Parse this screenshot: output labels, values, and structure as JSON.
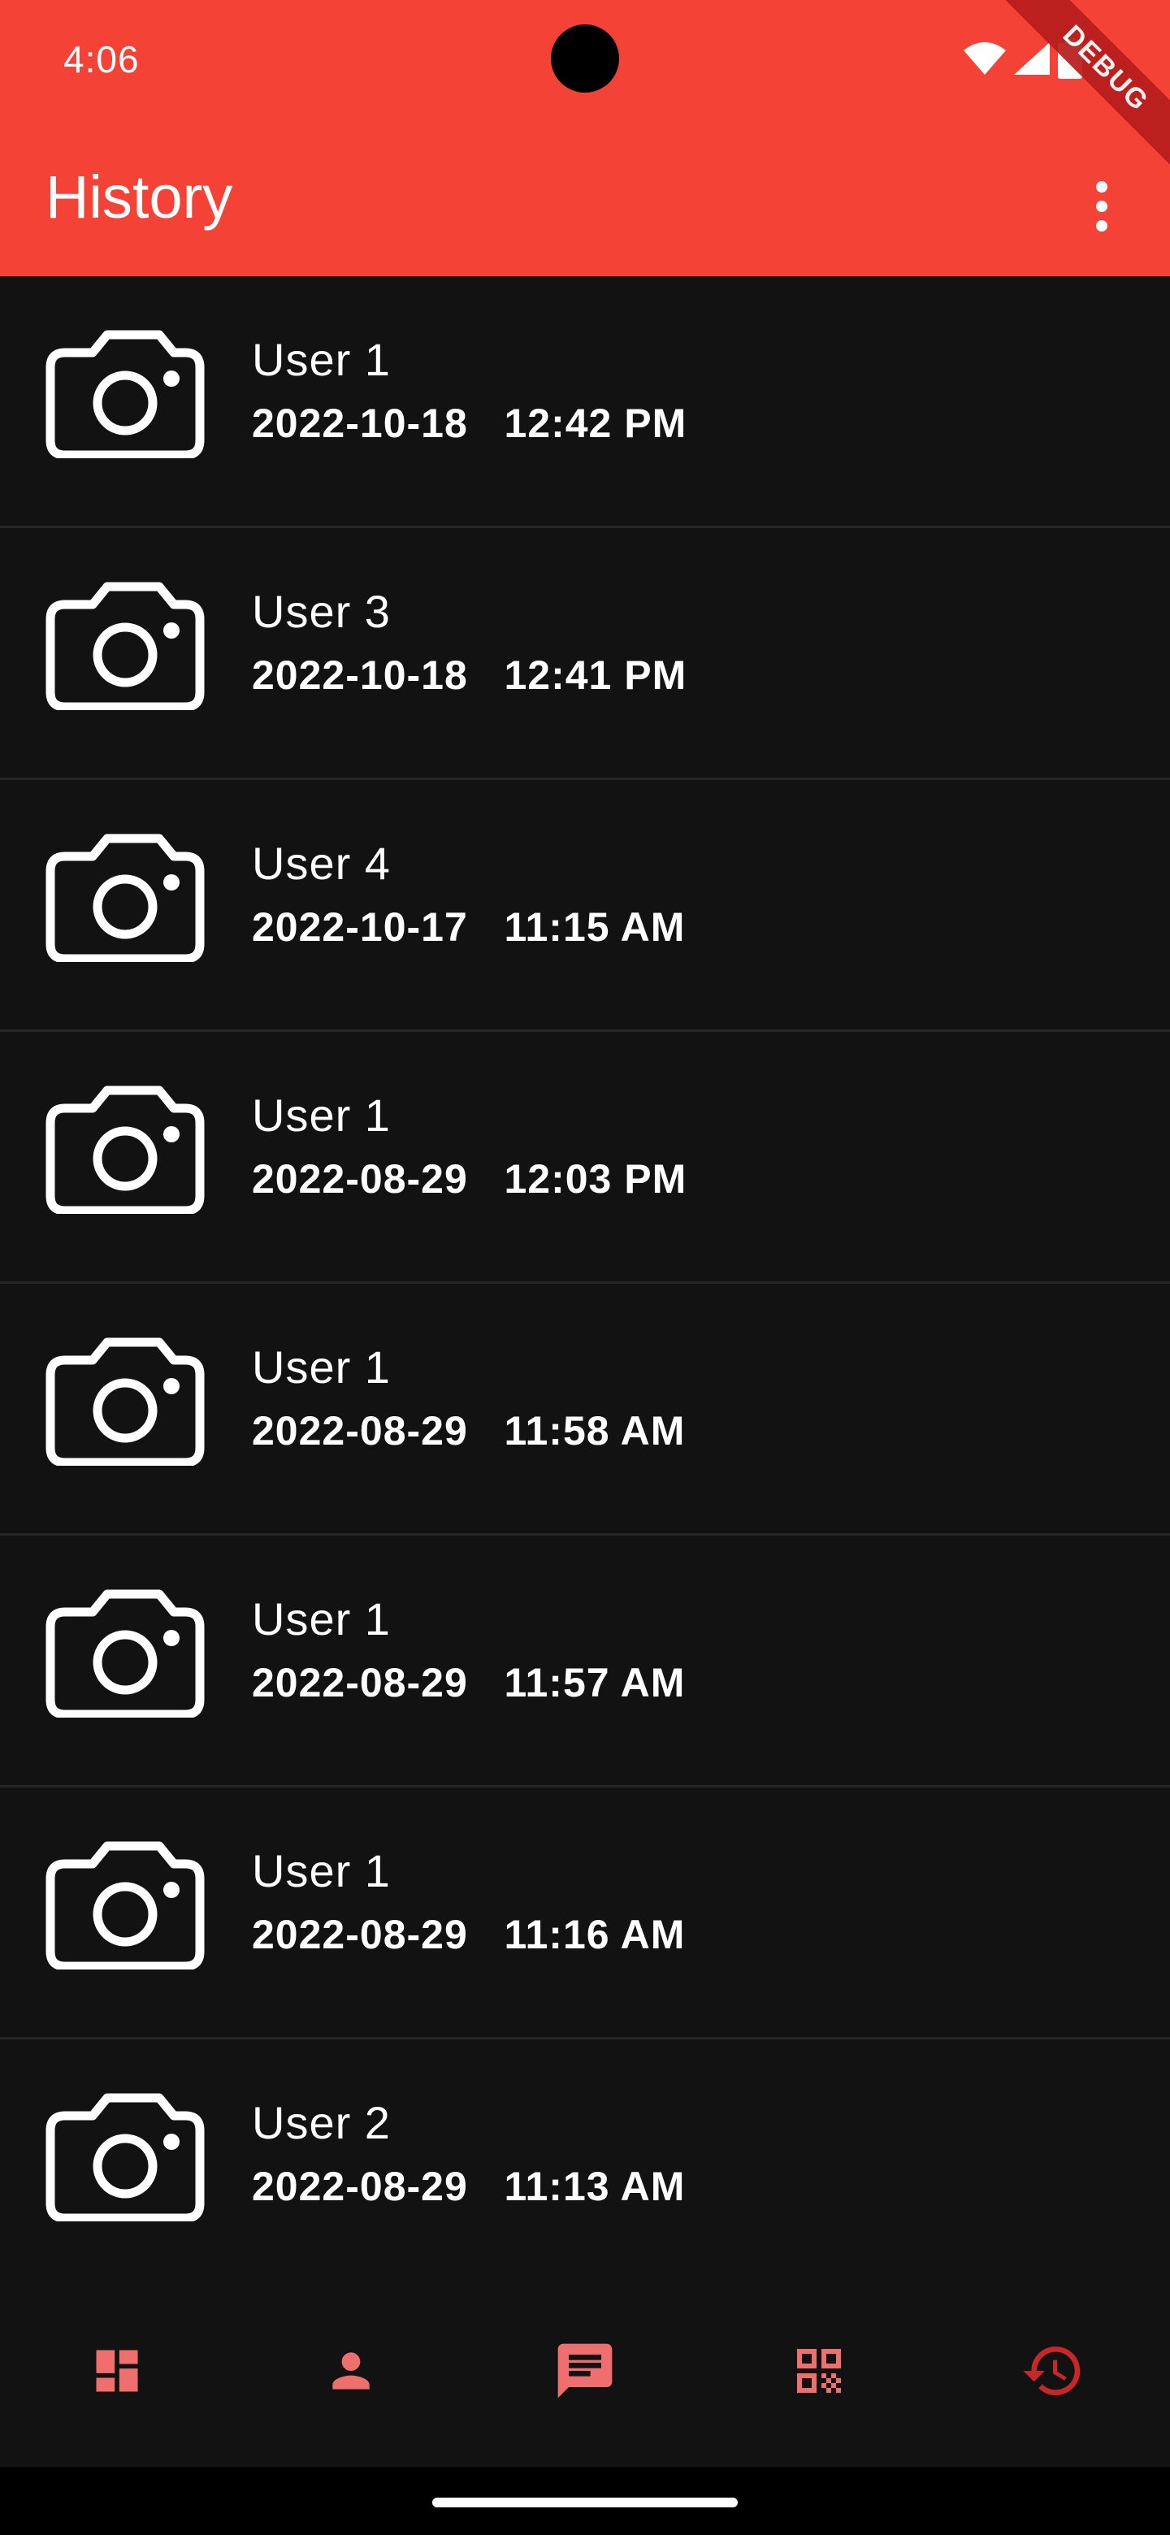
{
  "status_bar": {
    "time": "4:06",
    "debug_label": "DEBUG"
  },
  "app_bar": {
    "title": "History",
    "menu_icon": "more-vert-icon"
  },
  "history": [
    {
      "user": "User 1",
      "date": "2022-10-18",
      "time": "12:42 PM",
      "icon": "camera-icon"
    },
    {
      "user": "User 3",
      "date": "2022-10-18",
      "time": "12:41 PM",
      "icon": "camera-icon"
    },
    {
      "user": "User 4",
      "date": "2022-10-17",
      "time": "11:15 AM",
      "icon": "camera-icon"
    },
    {
      "user": "User 1",
      "date": "2022-08-29",
      "time": "12:03 PM",
      "icon": "camera-icon"
    },
    {
      "user": "User 1",
      "date": "2022-08-29",
      "time": "11:58 AM",
      "icon": "camera-icon"
    },
    {
      "user": "User 1",
      "date": "2022-08-29",
      "time": "11:57 AM",
      "icon": "camera-icon"
    },
    {
      "user": "User 1",
      "date": "2022-08-29",
      "time": "11:16 AM",
      "icon": "camera-icon"
    },
    {
      "user": "User 2",
      "date": "2022-08-29",
      "time": "11:13 AM",
      "icon": "camera-icon"
    }
  ],
  "bottom_nav": {
    "items": [
      {
        "icon": "dashboard-icon",
        "selected": false
      },
      {
        "icon": "person-icon",
        "selected": false
      },
      {
        "icon": "chat-icon",
        "selected": false
      },
      {
        "icon": "qr-code-icon",
        "selected": false
      },
      {
        "icon": "history-icon",
        "selected": true
      }
    ]
  },
  "colors": {
    "accent": "#F44336",
    "nav_inactive": "#EF6F6F",
    "nav_active": "#C62828",
    "background": "#121212",
    "text": "#FFFFFF"
  }
}
